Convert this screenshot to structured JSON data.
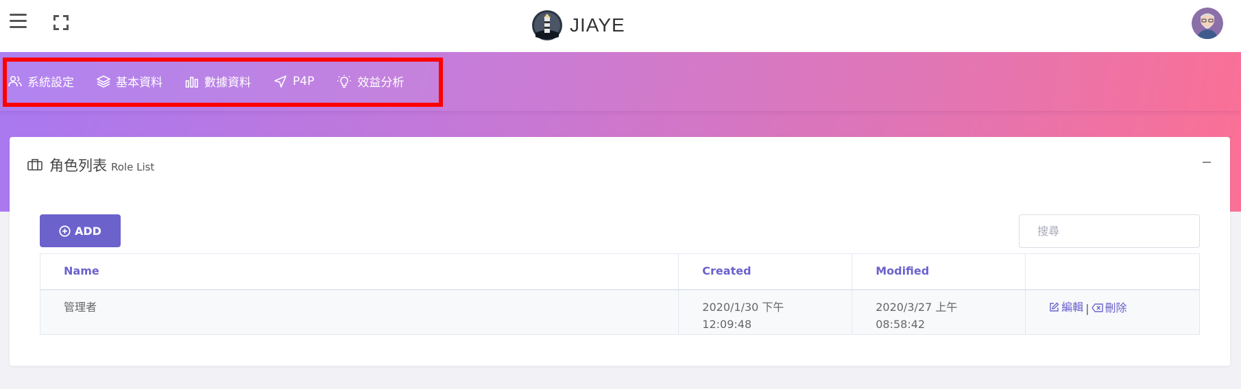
{
  "header": {
    "brand": "JIAYE",
    "icons": {
      "menu": "hamburger-icon",
      "fullscreen": "expand-icon",
      "logo": "lighthouse-logo",
      "avatar": "user-avatar"
    }
  },
  "nav": {
    "items": [
      {
        "label": "系統設定",
        "icon": "users-icon"
      },
      {
        "label": "基本資料",
        "icon": "layers-icon"
      },
      {
        "label": "數據資料",
        "icon": "bar-chart-icon"
      },
      {
        "label": "P4P",
        "icon": "send-icon"
      },
      {
        "label": "效益分析",
        "icon": "lightbulb-icon"
      }
    ],
    "highlight_color": "#ff0000"
  },
  "card": {
    "title_zh": "角色列表",
    "title_en": "Role List",
    "add_label": "ADD",
    "search_placeholder": "搜尋",
    "table": {
      "headers": [
        "Name",
        "Created",
        "Modified",
        ""
      ],
      "rows": [
        {
          "name": "管理者",
          "created": "2020/1/30 下午 12:09:48",
          "modified": "2020/3/27 上午 08:58:42",
          "edit_label": "編輯",
          "delete_label": "刪除"
        }
      ]
    }
  },
  "colors": {
    "accent": "#6b62cc",
    "gradient_start": "#a978f0",
    "gradient_end": "#fb7095"
  }
}
